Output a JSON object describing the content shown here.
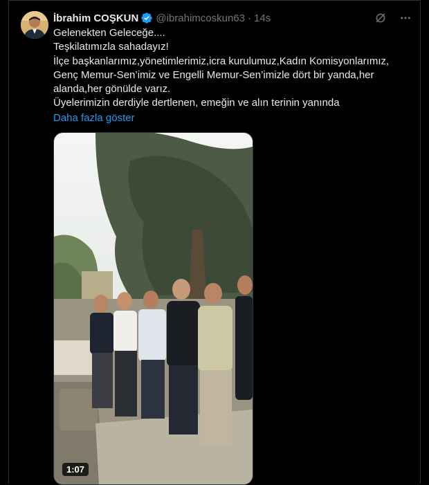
{
  "author": {
    "name": "İbrahim COŞKUN",
    "handle": "@ibrahimcoskun63",
    "separator": "·",
    "time": "14s",
    "verified_color": "#1d9bf0"
  },
  "tweet": {
    "lines": [
      "Gelenekten Geleceğe....",
      "Teşkilatımızla sahadayız!",
      "İlçe başkanlarımız,yönetimlerimiz,icra kurulumuz,Kadın Komisyonlarımız,",
      "Genç Memur-Sen’imiz ve Engelli Memur-Sen’imizle dört bir yanda,her",
      "alanda,her gönülde varız.",
      "Üyelerimizin derdiyle dertlenen, emeğin ve alın terinin yanında"
    ],
    "show_more": "Daha fazla göster"
  },
  "media": {
    "type": "video",
    "duration": "1:07"
  },
  "icons": {
    "grok": "grok-icon",
    "more": "more-options-icon",
    "verified": "verified-badge-icon"
  },
  "colors": {
    "background": "#000000",
    "text": "#e7e9ea",
    "secondary": "#71767b",
    "link": "#1d9bf0"
  }
}
